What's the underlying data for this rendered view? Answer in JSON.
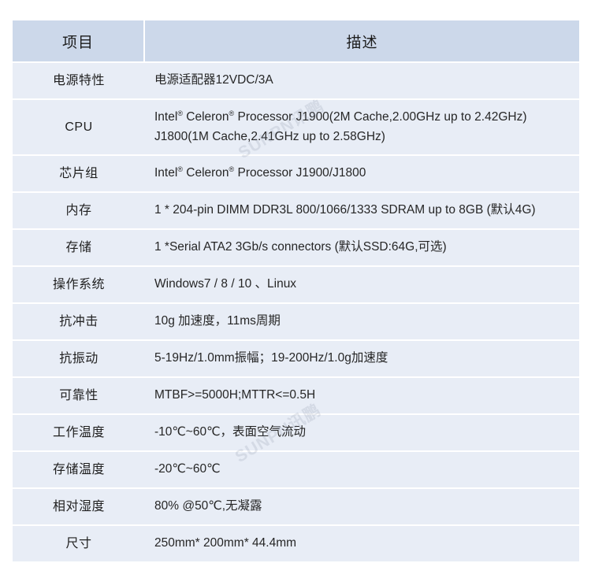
{
  "table": {
    "headers": {
      "item": "项目",
      "description": "描述"
    },
    "rows": [
      {
        "item": "电源特性",
        "lines": [
          "电源适配器12VDC/3A"
        ]
      },
      {
        "item": "CPU",
        "lines": [
          "Intel® Celeron® Processor J1900(2M Cache,2.00GHz up to 2.42GHz)",
          "J1800(1M Cache,2.41GHz up to 2.58GHz)"
        ]
      },
      {
        "item": "芯片组",
        "lines": [
          "Intel® Celeron® Processor J1900/J1800"
        ]
      },
      {
        "item": "内存",
        "lines": [
          "1 * 204-pin DIMM DDR3L 800/1066/1333 SDRAM up to 8GB (默认4G)"
        ]
      },
      {
        "item": "存储",
        "lines": [
          "1 *Serial ATA2 3Gb/s connectors (默认SSD:64G,可选)"
        ]
      },
      {
        "item": "操作系统",
        "lines": [
          "Windows7 / 8 / 10 、Linux"
        ]
      },
      {
        "item": "抗冲击",
        "lines": [
          "10g 加速度，11ms周期"
        ]
      },
      {
        "item": "抗振动",
        "lines": [
          "5-19Hz/1.0mm振幅；19-200Hz/1.0g加速度"
        ]
      },
      {
        "item": "可靠性",
        "lines": [
          "MTBF>=5000H;MTTR<=0.5H"
        ]
      },
      {
        "item": "工作温度",
        "lines": [
          "-10℃~60℃，表面空气流动"
        ]
      },
      {
        "item": "存储温度",
        "lines": [
          "-20℃~60℃"
        ]
      },
      {
        "item": "相对湿度",
        "lines": [
          "80% @50℃,无凝露"
        ]
      },
      {
        "item": "尺寸",
        "lines": [
          "250mm* 200mm* 44.4mm"
        ]
      }
    ]
  },
  "watermark": {
    "text": "SUNPN讯鹏"
  },
  "colors": {
    "header_bg": "#ccd8ea",
    "cell_bg": "#e8edf6",
    "page_bg": "#ffffff",
    "text": "#262626"
  }
}
